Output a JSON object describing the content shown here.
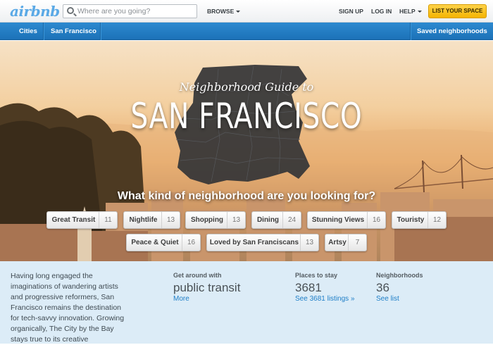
{
  "header": {
    "logo": "airbnb",
    "search_placeholder": "Where are you going?",
    "browse": "BROWSE",
    "signup": "SIGN UP",
    "login": "LOG IN",
    "help": "HELP",
    "list_space": "LIST YOUR SPACE"
  },
  "subnav": {
    "cities": "Cities",
    "city": "San Francisco",
    "saved": "Saved neighborhoods"
  },
  "hero": {
    "subtitle": "Neighborhood Guide to",
    "title": "SAN FRANCISCO",
    "question": "What kind of neighborhood are you looking for?",
    "tags": [
      {
        "label": "Great Transit",
        "count": "11"
      },
      {
        "label": "Nightlife",
        "count": "13"
      },
      {
        "label": "Shopping",
        "count": "13"
      },
      {
        "label": "Dining",
        "count": "24"
      },
      {
        "label": "Stunning Views",
        "count": "16"
      },
      {
        "label": "Touristy",
        "count": "12"
      },
      {
        "label": "Peace & Quiet",
        "count": "16"
      },
      {
        "label": "Loved by San Franciscans",
        "count": "13"
      },
      {
        "label": "Artsy",
        "count": "7"
      }
    ]
  },
  "info": {
    "intro": "Having long engaged the imaginations of wandering artists and progressive reformers, San Francisco remains the destination for tech-savvy innovation. Growing organically, The City by the Bay stays true to its creative",
    "get_around": {
      "label": "Get around with",
      "value": "public transit",
      "link": "More"
    },
    "places": {
      "label": "Places to stay",
      "value": "3681",
      "link": "See 3681 listings »"
    },
    "neighborhoods": {
      "label": "Neighborhoods",
      "value": "36",
      "link": "See list"
    }
  },
  "colors": {
    "accent_blue": "#1c72b8",
    "list_button": "#f4b400",
    "info_bg": "#dcecf7",
    "link": "#1e7ec7"
  },
  "icons": [
    "search-icon",
    "chevron-down-icon"
  ]
}
